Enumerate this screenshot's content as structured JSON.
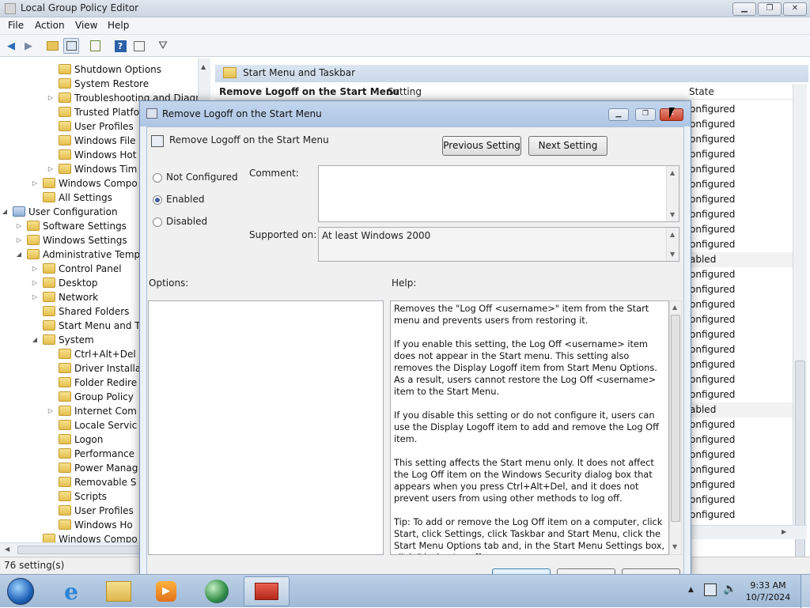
{
  "window": {
    "title": "Local Group Policy Editor",
    "controls": {
      "minimize": "▁",
      "maximize": "❐",
      "close": "✕"
    }
  },
  "menu": [
    "File",
    "Action",
    "View",
    "Help"
  ],
  "toolbar_icons": [
    "back-arrow-icon",
    "forward-arrow-icon",
    "up-folder-icon",
    "show-hide-tree-icon",
    "export-list-icon",
    "help-icon",
    "properties-icon",
    "filter-icon"
  ],
  "tree": [
    {
      "label": "Shutdown Options",
      "level": 4,
      "expand": ""
    },
    {
      "label": "System Restore",
      "level": 4,
      "expand": ""
    },
    {
      "label": "Troubleshooting and Diagn",
      "level": 4,
      "expand": "▷"
    },
    {
      "label": "Trusted Platfo",
      "level": 4,
      "expand": ""
    },
    {
      "label": "User Profiles",
      "level": 4,
      "expand": ""
    },
    {
      "label": "Windows File",
      "level": 4,
      "expand": ""
    },
    {
      "label": "Windows Hot",
      "level": 4,
      "expand": ""
    },
    {
      "label": "Windows Tim",
      "level": 4,
      "expand": "▷"
    },
    {
      "label": "Windows Compo",
      "level": 3,
      "expand": "▷"
    },
    {
      "label": "All Settings",
      "level": 3,
      "expand": ""
    },
    {
      "label": "User Configuration",
      "level": 1,
      "expand": "◢"
    },
    {
      "label": "Software Settings",
      "level": 2,
      "expand": "▷"
    },
    {
      "label": "Windows Settings",
      "level": 2,
      "expand": "▷"
    },
    {
      "label": "Administrative Temp",
      "level": 2,
      "expand": "◢"
    },
    {
      "label": "Control Panel",
      "level": 3,
      "expand": "▷"
    },
    {
      "label": "Desktop",
      "level": 3,
      "expand": "▷"
    },
    {
      "label": "Network",
      "level": 3,
      "expand": "▷"
    },
    {
      "label": "Shared Folders",
      "level": 3,
      "expand": ""
    },
    {
      "label": "Start Menu and T",
      "level": 3,
      "expand": ""
    },
    {
      "label": "System",
      "level": 3,
      "expand": "◢"
    },
    {
      "label": "Ctrl+Alt+Del",
      "level": 4,
      "expand": ""
    },
    {
      "label": "Driver Installa",
      "level": 4,
      "expand": ""
    },
    {
      "label": "Folder Redire",
      "level": 4,
      "expand": ""
    },
    {
      "label": "Group Policy",
      "level": 4,
      "expand": ""
    },
    {
      "label": "Internet Com",
      "level": 4,
      "expand": "▷"
    },
    {
      "label": "Locale Servic",
      "level": 4,
      "expand": ""
    },
    {
      "label": "Logon",
      "level": 4,
      "expand": ""
    },
    {
      "label": "Performance",
      "level": 4,
      "expand": ""
    },
    {
      "label": "Power Manag",
      "level": 4,
      "expand": ""
    },
    {
      "label": "Removable S",
      "level": 4,
      "expand": ""
    },
    {
      "label": "Scripts",
      "level": 4,
      "expand": ""
    },
    {
      "label": "User Profiles",
      "level": 4,
      "expand": ""
    },
    {
      "label": "Windows Ho",
      "level": 4,
      "expand": ""
    },
    {
      "label": "Windows Compo",
      "level": 3,
      "expand": ""
    }
  ],
  "right_panel": {
    "header": "Start Menu and Taskbar",
    "selected_setting": "Remove Logoff on the Start Menu",
    "col_setting": "Setting",
    "col_state": "State",
    "states": [
      "onfigured",
      "onfigured",
      "onfigured",
      "onfigured",
      "onfigured",
      "onfigured",
      "onfigured",
      "onfigured",
      "onfigured",
      "onfigured",
      "abled",
      "onfigured",
      "onfigured",
      "onfigured",
      "onfigured",
      "onfigured",
      "onfigured",
      "onfigured",
      "onfigured",
      "onfigured",
      "abled",
      "onfigured",
      "onfigured",
      "onfigured",
      "onfigured",
      "onfigured",
      "onfigured",
      "onfigured"
    ]
  },
  "status": "76 setting(s)",
  "dialog": {
    "title": "Remove Logoff on the Start Menu",
    "setting_name": "Remove Logoff on the Start Menu",
    "prev_button": "Previous Setting",
    "next_button": "Next Setting",
    "radio_not_configured": "Not Configured",
    "radio_enabled": "Enabled",
    "radio_disabled": "Disabled",
    "selected": "Enabled",
    "comment_label": "Comment:",
    "comment_value": "",
    "supported_label": "Supported on:",
    "supported_value": "At least Windows 2000",
    "options_label": "Options:",
    "help_label": "Help:",
    "help_paragraphs": [
      "Removes the \"Log Off <username>\" item from the Start menu and prevents users from restoring it.",
      "If you enable this setting, the Log Off <username> item does not appear in the Start menu. This setting also removes the Display Logoff item from Start Menu Options. As a result, users cannot restore the Log Off <username> item to the Start Menu.",
      "If you disable this setting or do not configure it, users can use the Display Logoff item to add and remove the Log Off item.",
      "This setting affects the Start menu only. It does not affect the Log Off item on the Windows Security dialog box that appears when you press Ctrl+Alt+Del, and it does not prevent users from using other methods to log off.",
      "Tip: To add or remove the Log Off item on a computer, click Start, click Settings, click Taskbar and Start Menu, click the Start Menu Options tab and, in the Start Menu Settings box, click Display Logoff."
    ]
  },
  "taskbar": {
    "apps": [
      "start-orb",
      "internet-explorer-icon",
      "windows-explorer-icon",
      "media-player-icon",
      "network-globe-icon",
      "toolbox-icon"
    ],
    "time": "9:33 AM",
    "date": "10/7/2024"
  },
  "colors": {
    "accent": "#3a6ea5",
    "enabled_dot": "#3a5f9a",
    "taskbar": "#a8c0dc"
  }
}
